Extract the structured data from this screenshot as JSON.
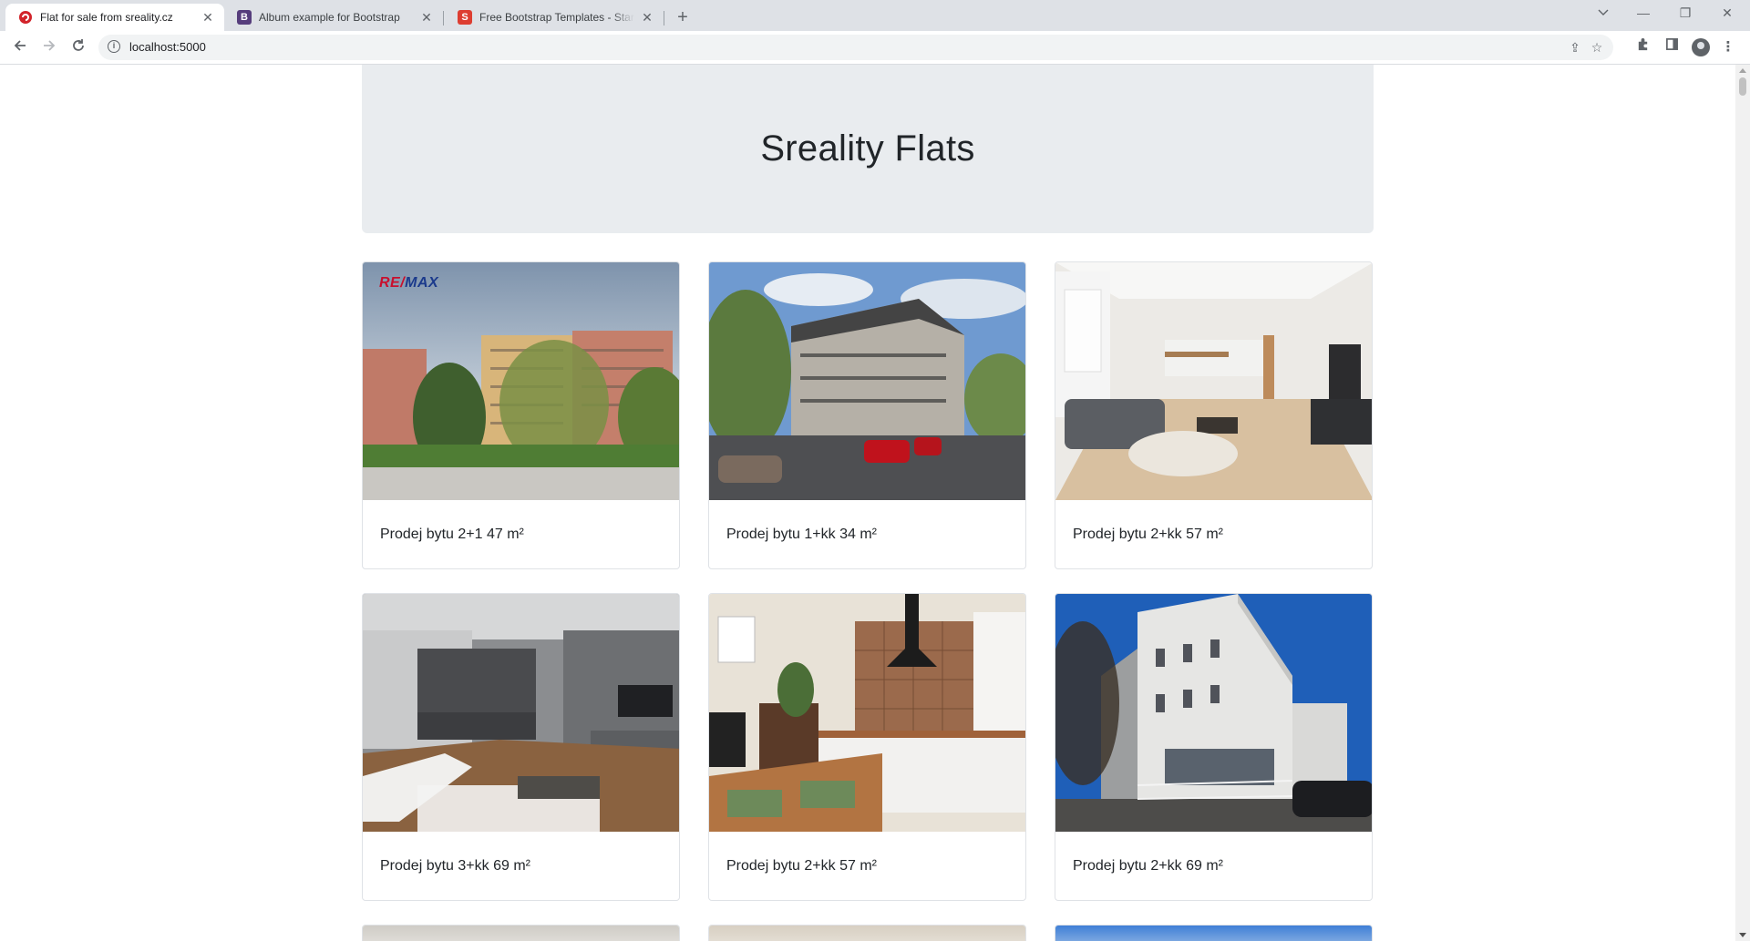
{
  "browser": {
    "tabs": [
      {
        "title": "Flat for sale from sreality.cz",
        "favicon": "sreality-red-icon",
        "active": true
      },
      {
        "title": "Album example for Bootstrap",
        "favicon": "bootstrap-b-icon",
        "active": false
      },
      {
        "title": "Free Bootstrap Templates - Start",
        "favicon": "startbootstrap-s-icon",
        "active": false
      }
    ],
    "url": "localhost:5000"
  },
  "page": {
    "heading": "Sreality Flats",
    "listings": [
      {
        "title": "Prodej bytu 2+1 47 m²",
        "image": "apartment-blocks-with-trees-photo",
        "watermark": "RE/MAX"
      },
      {
        "title": "Prodej bytu 1+kk 34 m²",
        "image": "renovated-building-with-cars-photo"
      },
      {
        "title": "Prodej bytu 2+kk 57 m²",
        "image": "bright-living-room-with-kitchen-photo"
      },
      {
        "title": "Prodej bytu 3+kk 69 m²",
        "image": "grey-living-room-with-sofa-photo"
      },
      {
        "title": "Prodej bytu 2+kk 57 m²",
        "image": "kitchen-with-patterned-tiles-photo"
      },
      {
        "title": "Prodej bytu 2+kk 69 m²",
        "image": "new-white-apartment-building-photo"
      }
    ]
  },
  "colors": {
    "jumbotron_bg": "#e9ecef",
    "tabstrip_bg": "#dee1e6"
  }
}
